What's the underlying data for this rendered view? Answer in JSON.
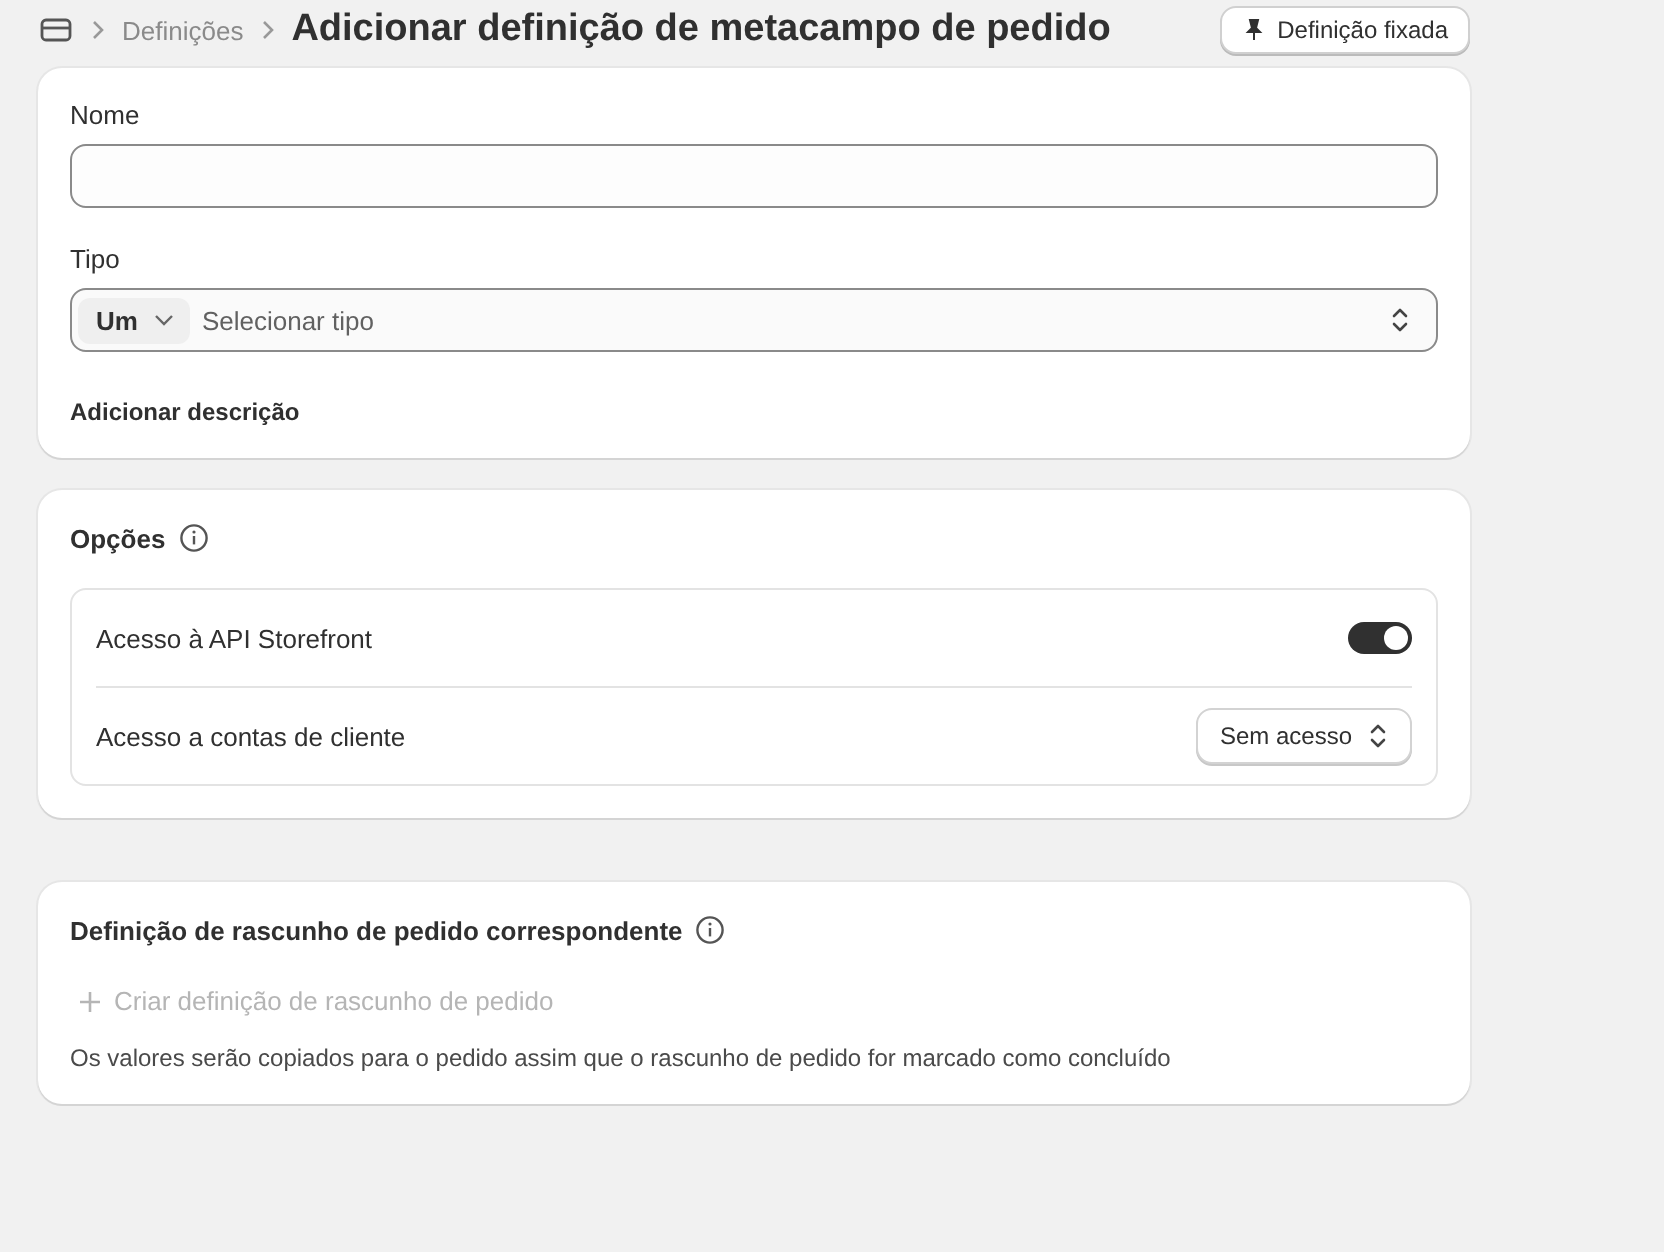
{
  "header": {
    "breadcrumb": "Definições",
    "title": "Adicionar definição de metacampo de pedido",
    "pin_button": "Definição fixada"
  },
  "details": {
    "name": {
      "label": "Nome"
    },
    "type": {
      "label": "Tipo",
      "prefix": "Um",
      "placeholder": "Selecionar tipo"
    },
    "add_description": "Adicionar descrição"
  },
  "options": {
    "title": "Opções",
    "rows": [
      {
        "kind": "toggle",
        "label": "Acesso à API Storefront",
        "on": true
      },
      {
        "kind": "select",
        "label": "Acesso a contas de cliente",
        "value": "Sem acesso"
      }
    ]
  },
  "draft": {
    "title": "Definição de rascunho de pedido correspondente",
    "create_button": {
      "label": "Criar definição de rascunho de pedido",
      "disabled": true
    },
    "note": "Os valores serão copiados para o pedido assim que o rascunho de pedido for marcado como concluído"
  }
}
